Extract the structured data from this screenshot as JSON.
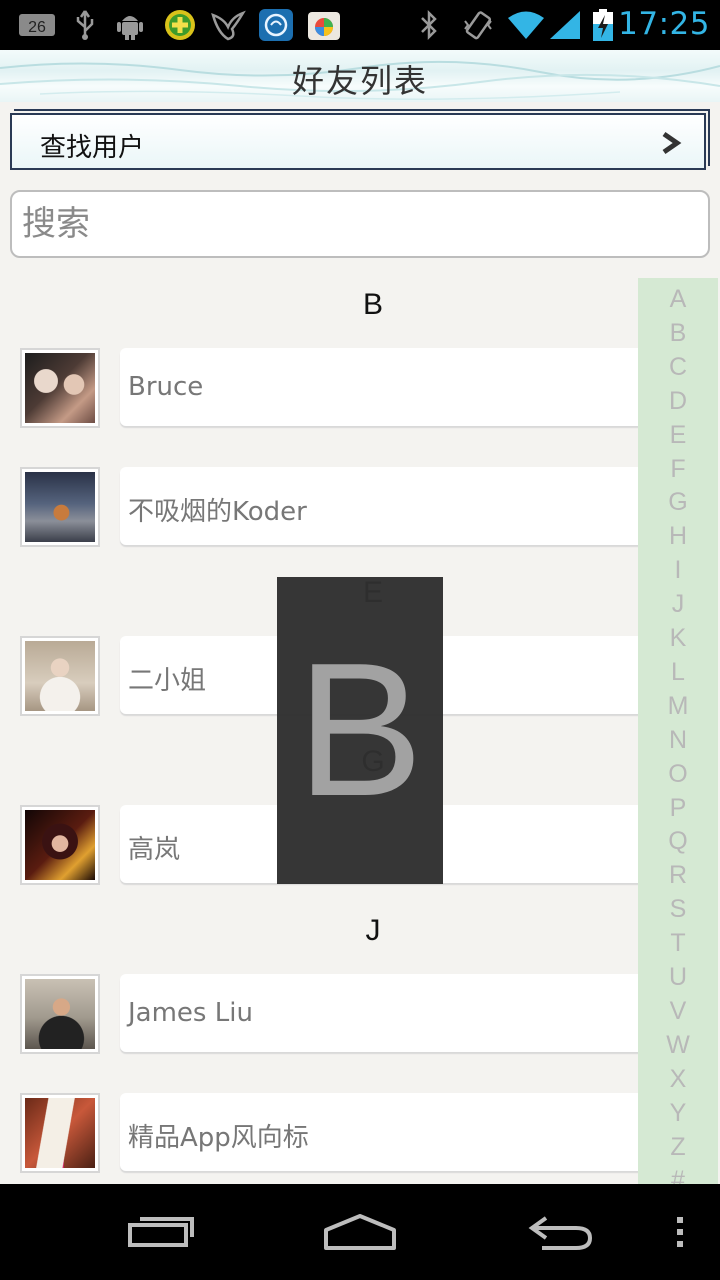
{
  "status_bar": {
    "time": "17:25",
    "icons": [
      "notification-badge-icon",
      "usb-icon",
      "android-debug-icon",
      "app-plus-icon",
      "bird-app-icon",
      "qq-app-icon",
      "store-app-icon",
      "bluetooth-icon",
      "vibrate-icon",
      "wifi-icon",
      "signal-icon",
      "battery-charging-icon"
    ],
    "badge_number": "26"
  },
  "header": {
    "title": "好友列表"
  },
  "find_user": {
    "label": "查找用户",
    "icon": "chevron-right-icon"
  },
  "search": {
    "placeholder": "搜索"
  },
  "sections": [
    {
      "letter": "B",
      "friends": [
        {
          "name": "Bruce",
          "avatar": "avatar-bruce"
        },
        {
          "name": "不吸烟的Koder",
          "avatar": "avatar-koder"
        }
      ]
    },
    {
      "letter": "E",
      "friends": [
        {
          "name": "二小姐",
          "avatar": "avatar-erxiaojie"
        }
      ]
    },
    {
      "letter": "G",
      "friends": [
        {
          "name": "高岚",
          "avatar": "avatar-gaolan"
        }
      ]
    },
    {
      "letter": "J",
      "friends": [
        {
          "name": "James Liu",
          "avatar": "avatar-james"
        },
        {
          "name": "精品App风向标",
          "avatar": "avatar-app"
        }
      ]
    }
  ],
  "index_letters": [
    "A",
    "B",
    "C",
    "D",
    "E",
    "F",
    "G",
    "H",
    "I",
    "J",
    "K",
    "L",
    "M",
    "N",
    "O",
    "P",
    "Q",
    "R",
    "S",
    "T",
    "U",
    "V",
    "W",
    "X",
    "Y",
    "Z",
    "#"
  ],
  "overlay_letter": "B",
  "colors": {
    "status_accent": "#33b5e5",
    "index_bar_bg": "#d5e9d3",
    "overlay_bg": "#303030"
  },
  "nav": {
    "icons": [
      "recent-apps-icon",
      "home-icon",
      "back-icon",
      "menu-overflow-icon"
    ]
  }
}
